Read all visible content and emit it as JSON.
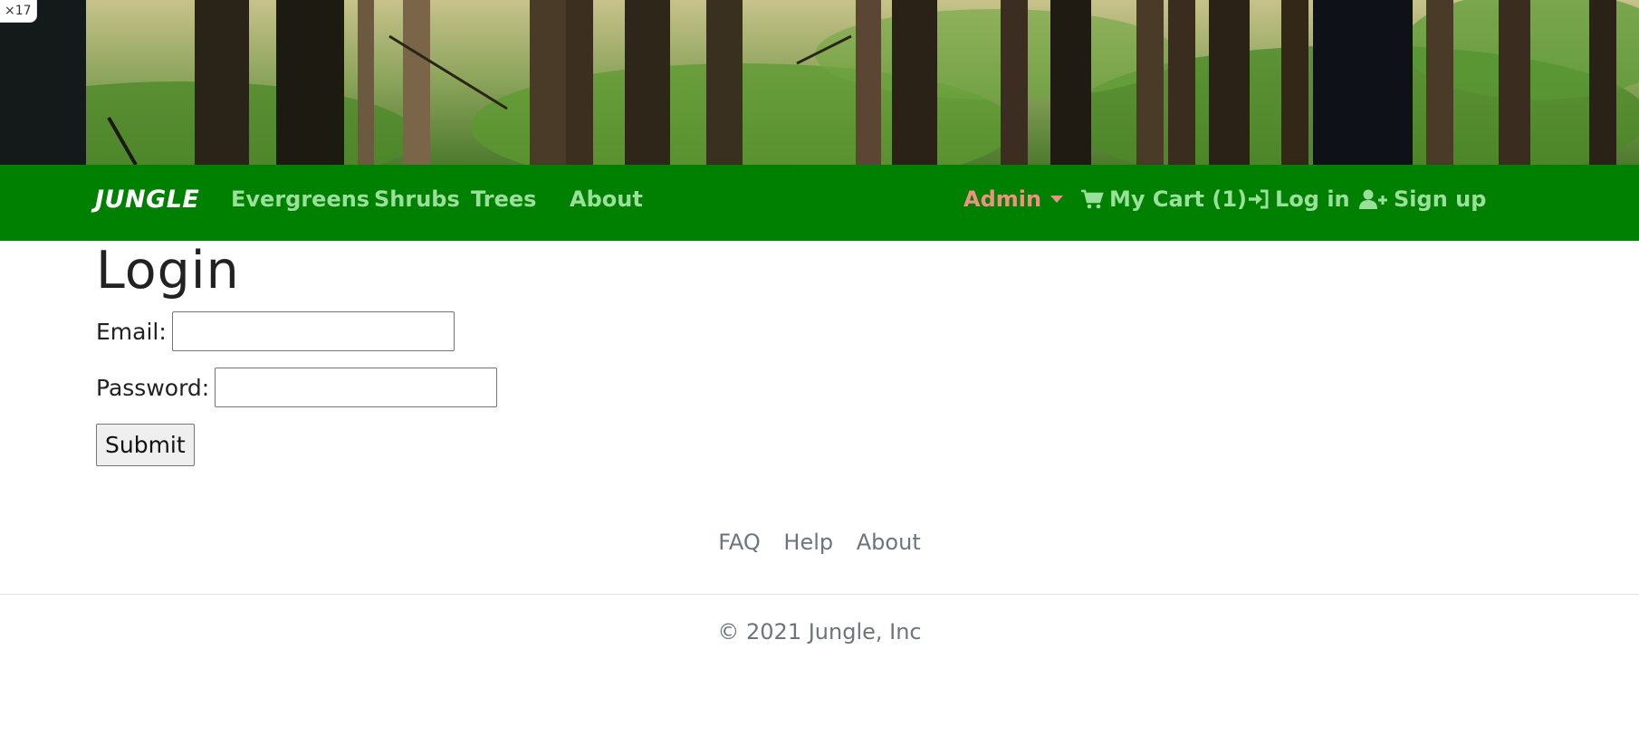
{
  "zoom_badge": "×17",
  "navbar": {
    "brand": "JUNGLE",
    "links": [
      "Evergreens",
      "Shrubs",
      "Trees",
      "About"
    ],
    "admin_label": "Admin",
    "cart_label": "My Cart (1)",
    "login_label": "Log in",
    "signup_label": "Sign up"
  },
  "page": {
    "title": "Login",
    "email_label": "Email:",
    "email_value": "",
    "password_label": "Password:",
    "password_value": "",
    "submit_label": "Submit"
  },
  "footer": {
    "links": [
      "FAQ",
      "Help",
      "About"
    ],
    "copyright": "© 2021 Jungle, Inc"
  },
  "colors": {
    "navbar_bg": "#008000",
    "nav_link": "#9be09a",
    "admin_link": "#f09080",
    "footer_text": "#6c757d"
  },
  "icons": {
    "cart": "shopping-cart-icon",
    "login": "sign-in-icon",
    "signup": "user-plus-icon"
  }
}
